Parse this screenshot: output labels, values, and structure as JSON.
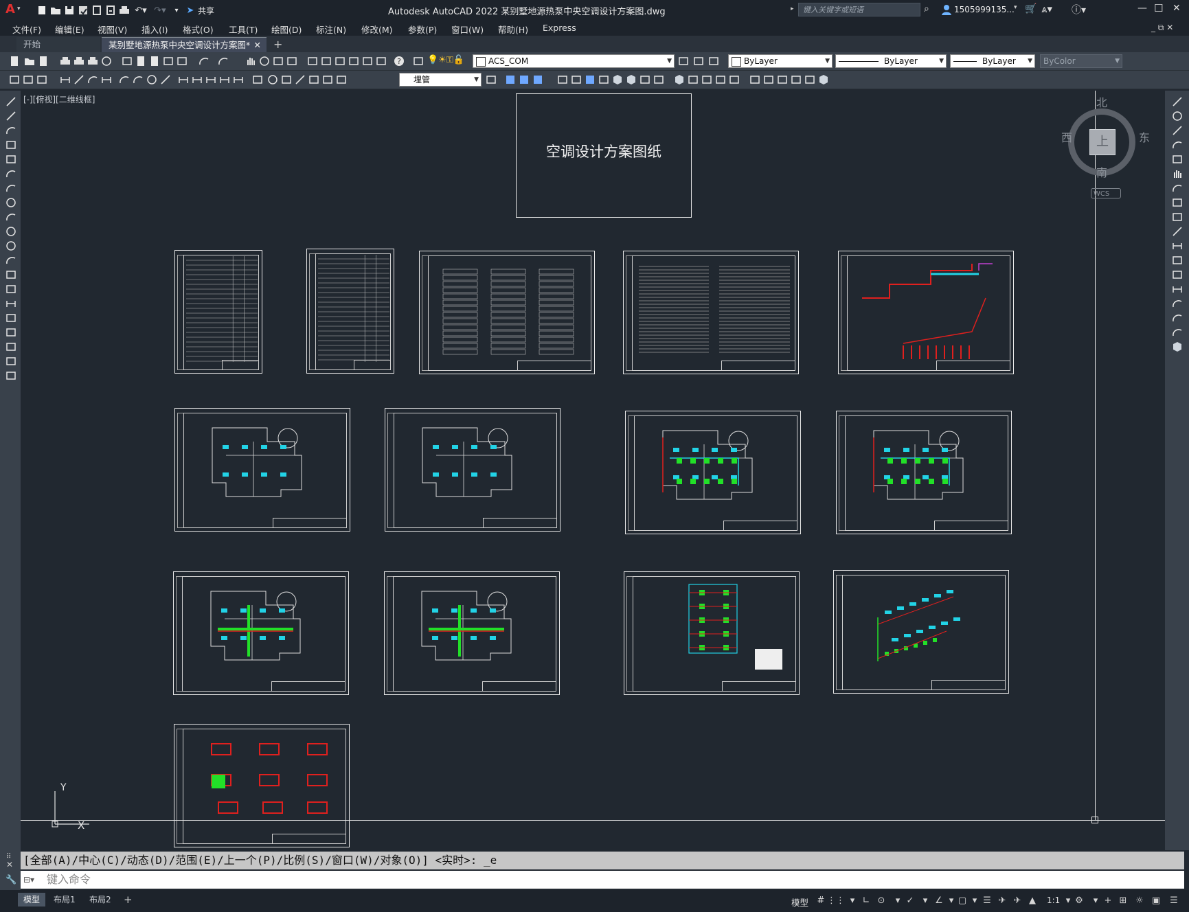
{
  "titlebar": {
    "app_letter": "A",
    "share_label": "共享",
    "app_title": "Autodesk AutoCAD 2022    某别墅地源热泵中央空调设计方案图.dwg",
    "search_placeholder": "键入关键字或短语",
    "user": "1505999135...",
    "win_min": "—",
    "win_max": "☐",
    "win_close": "✕"
  },
  "menu": [
    "文件(F)",
    "编辑(E)",
    "视图(V)",
    "插入(I)",
    "格式(O)",
    "工具(T)",
    "绘图(D)",
    "标注(N)",
    "修改(M)",
    "参数(P)",
    "窗口(W)",
    "帮助(H)",
    "Express"
  ],
  "tabs": {
    "start": "开始",
    "active": "某别墅地源热泵中央空调设计方案图*",
    "close": "✕",
    "add": "+"
  },
  "toolbar": {
    "layer_value": "ACS_COM",
    "color_value": "ByLayer",
    "linetype_value": "ByLayer",
    "lineweight_value": "ByLayer",
    "plotstyle_value": "ByColor",
    "dimstyle_value": "埋管"
  },
  "viewport": {
    "label": "[-][俯视][二维线框]",
    "cover_title": "空调设计方案图纸",
    "viewcube": {
      "north": "北",
      "south": "南",
      "east": "东",
      "west": "西",
      "top": "上",
      "wcs": "WCS"
    },
    "ucs": {
      "x": "X",
      "y": "Y"
    }
  },
  "command": {
    "history": "[全部(A)/中心(C)/动态(D)/范围(E)/上一个(P)/比例(S)/窗口(W)/对象(O)] <实时>: _e",
    "placeholder": "键入命令"
  },
  "status": {
    "layout_tabs": [
      "模型",
      "布局1",
      "布局2"
    ],
    "add_tab": "+",
    "model_label": "模型",
    "scale": "1:1"
  },
  "colors": {
    "background": "#212830",
    "chrome": "#39414b",
    "accent_red": "#d9252b",
    "pipe_cyan": "#22d3e6",
    "pipe_green": "#22e028",
    "pipe_red": "#e0201e"
  }
}
